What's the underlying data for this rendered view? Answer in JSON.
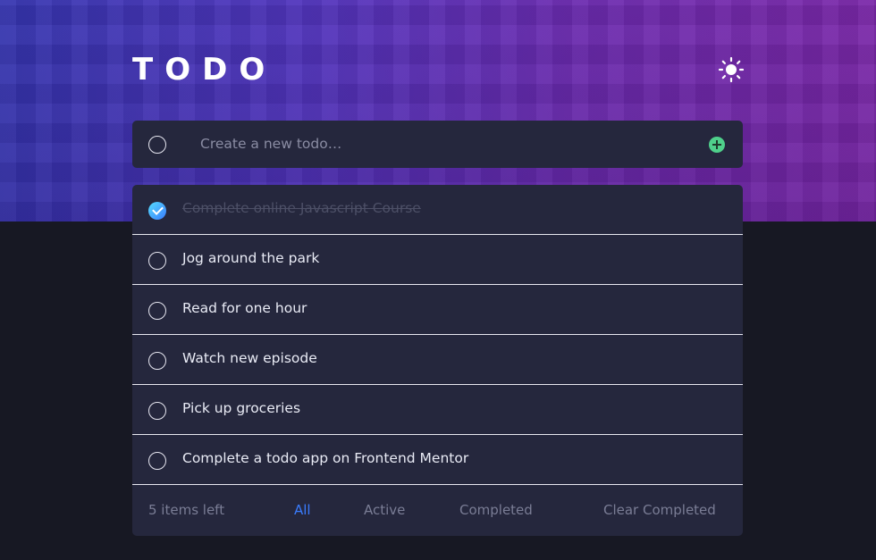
{
  "app": {
    "title": "TODO"
  },
  "new_todo": {
    "placeholder": "Create a new todo…"
  },
  "todos": [
    {
      "text": "Complete online Javascript Course",
      "completed": true
    },
    {
      "text": "Jog around the park",
      "completed": false
    },
    {
      "text": "Read for one hour",
      "completed": false
    },
    {
      "text": "Watch new episode",
      "completed": false
    },
    {
      "text": "Pick up groceries",
      "completed": false
    },
    {
      "text": "Complete a todo app on Frontend Mentor",
      "completed": false
    }
  ],
  "footer": {
    "items_left": "5 items left",
    "filters": [
      "All",
      "Active",
      "Completed"
    ],
    "active_filter": "All",
    "clear_label": "Clear Completed"
  },
  "icons": {
    "theme_toggle": "sun-icon",
    "add": "plus-icon"
  },
  "colors": {
    "accent": "#3a7cfd",
    "add_button": "#4fd08b",
    "card": "#25273d",
    "background": "#171823"
  }
}
